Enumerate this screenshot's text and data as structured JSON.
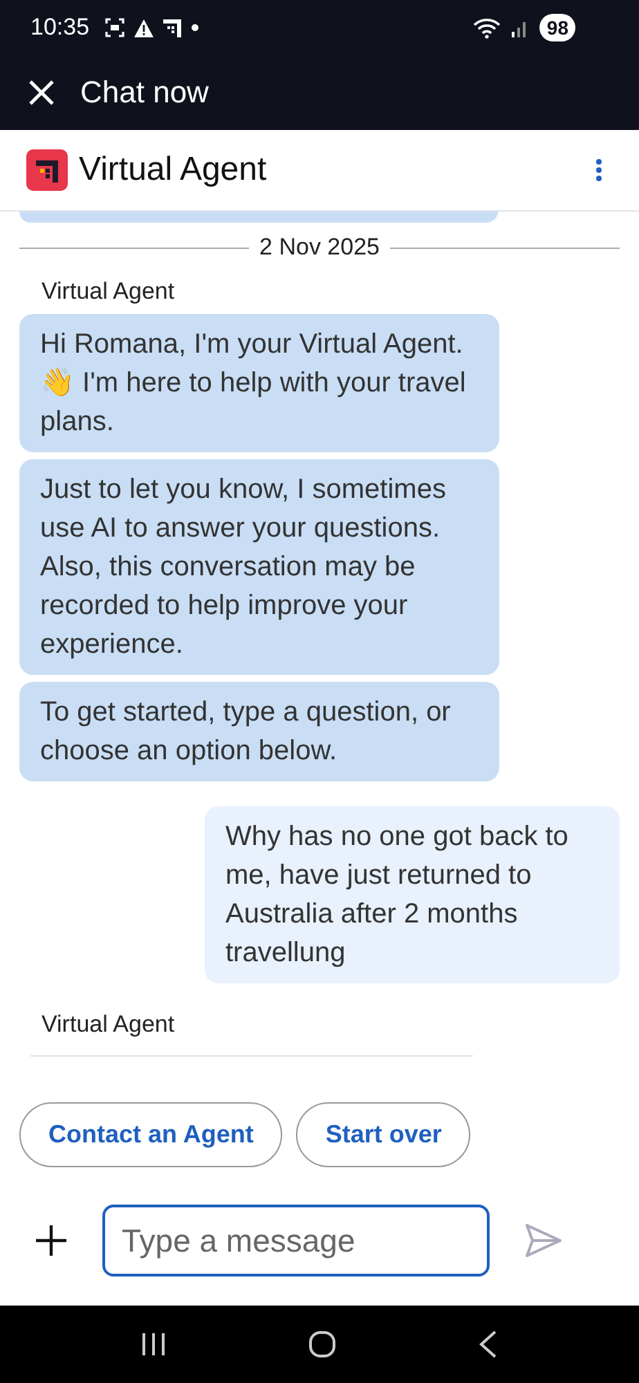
{
  "status_bar": {
    "time": "10:35",
    "battery": "98"
  },
  "app_bar": {
    "title": "Chat now"
  },
  "header": {
    "title": "Virtual Agent"
  },
  "chat": {
    "date": "2 Nov 2025",
    "messages": [
      {
        "kind": "label",
        "text": "Virtual Agent"
      },
      {
        "kind": "agent",
        "text": "Hi Romana, I'm your Virtual Agent. 👋 I'm here to help with your travel plans."
      },
      {
        "kind": "agent",
        "text": "Just to let you know, I sometimes use AI to answer your questions. Also, this conversation may be recorded to help improve your experience."
      },
      {
        "kind": "agent",
        "text": "To get started, type a question, or choose an option below."
      },
      {
        "kind": "user",
        "text": "Why has no one got back to me, have just returned to Australia after 2 months travellung"
      },
      {
        "kind": "label",
        "text": "Virtual Agent"
      }
    ]
  },
  "quick_replies": [
    "Contact an Agent",
    "Start over"
  ],
  "composer": {
    "placeholder": "Type a message"
  }
}
